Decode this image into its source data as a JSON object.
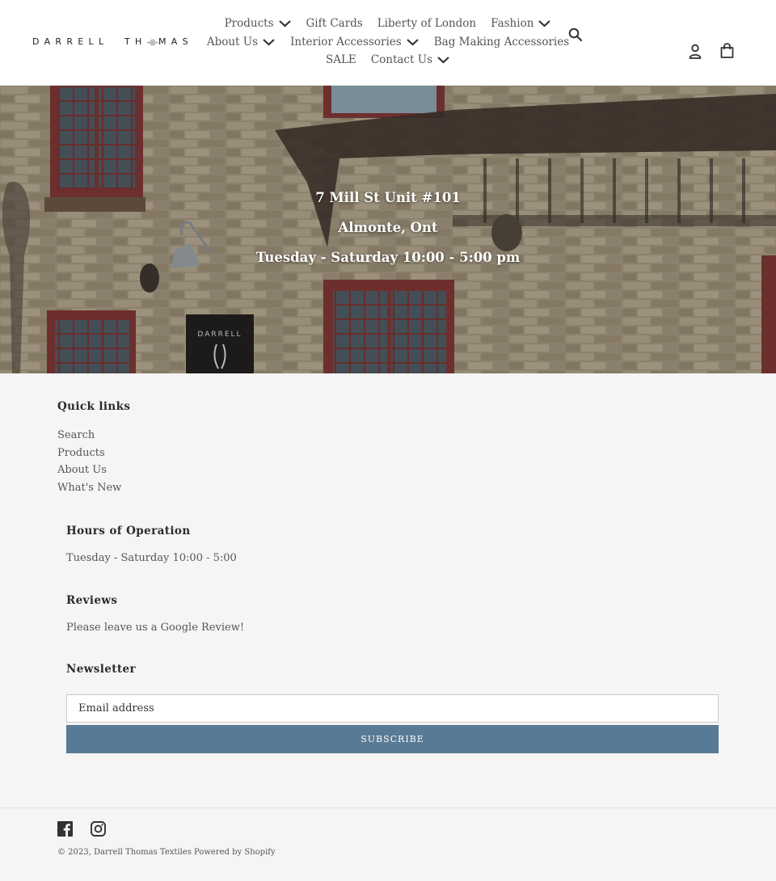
{
  "header": {
    "logo_left": "DARRELL",
    "logo_right_1": "TH",
    "logo_right_o": "O",
    "logo_right_2": "MAS",
    "nav": {
      "rows": [
        [
          {
            "label": "Products",
            "dropdown": true
          },
          {
            "label": "Gift Cards",
            "dropdown": false
          },
          {
            "label": "Liberty of London",
            "dropdown": false
          },
          {
            "label": "Fashion",
            "dropdown": true
          }
        ],
        [
          {
            "label": "About Us",
            "dropdown": true
          },
          {
            "label": "Interior Accessories",
            "dropdown": true
          },
          {
            "label": "Bag Making Accessories",
            "dropdown": false
          }
        ],
        [
          {
            "label": "SALE",
            "dropdown": false
          },
          {
            "label": "Contact Us",
            "dropdown": true
          }
        ]
      ]
    },
    "icons": {
      "search": "search-icon",
      "account": "account-icon",
      "cart": "cart-icon"
    }
  },
  "hero": {
    "line1": "7 Mill St Unit #101",
    "line2": "Almonte, Ont",
    "line3": "Tuesday - Saturday 10:00 - 5:00 pm",
    "sign_text": "DARRELL"
  },
  "footer": {
    "quick_links": {
      "heading": "Quick links",
      "items": [
        "Search",
        "Products",
        "About Us",
        "What's New"
      ]
    },
    "hours": {
      "heading": "Hours of Operation",
      "text": "Tuesday - Saturday 10:00 - 5:00"
    },
    "reviews": {
      "heading": "Reviews",
      "text": "Please leave us a Google Review!"
    },
    "newsletter": {
      "heading": "Newsletter",
      "email_placeholder": "Email address",
      "email_value": "",
      "subscribe_label": "SUBSCRIBE"
    },
    "social": [
      "facebook-icon",
      "instagram-icon"
    ],
    "copyright_prefix": "© 2023,",
    "store_name": "Darrell Thomas Textiles",
    "powered_by": "Powered by Shopify"
  },
  "colors": {
    "accent_button": "#587a95",
    "footer_bg": "#f5f5f5",
    "header_bg": "#ffffff",
    "hero_text": "#ffffff"
  }
}
